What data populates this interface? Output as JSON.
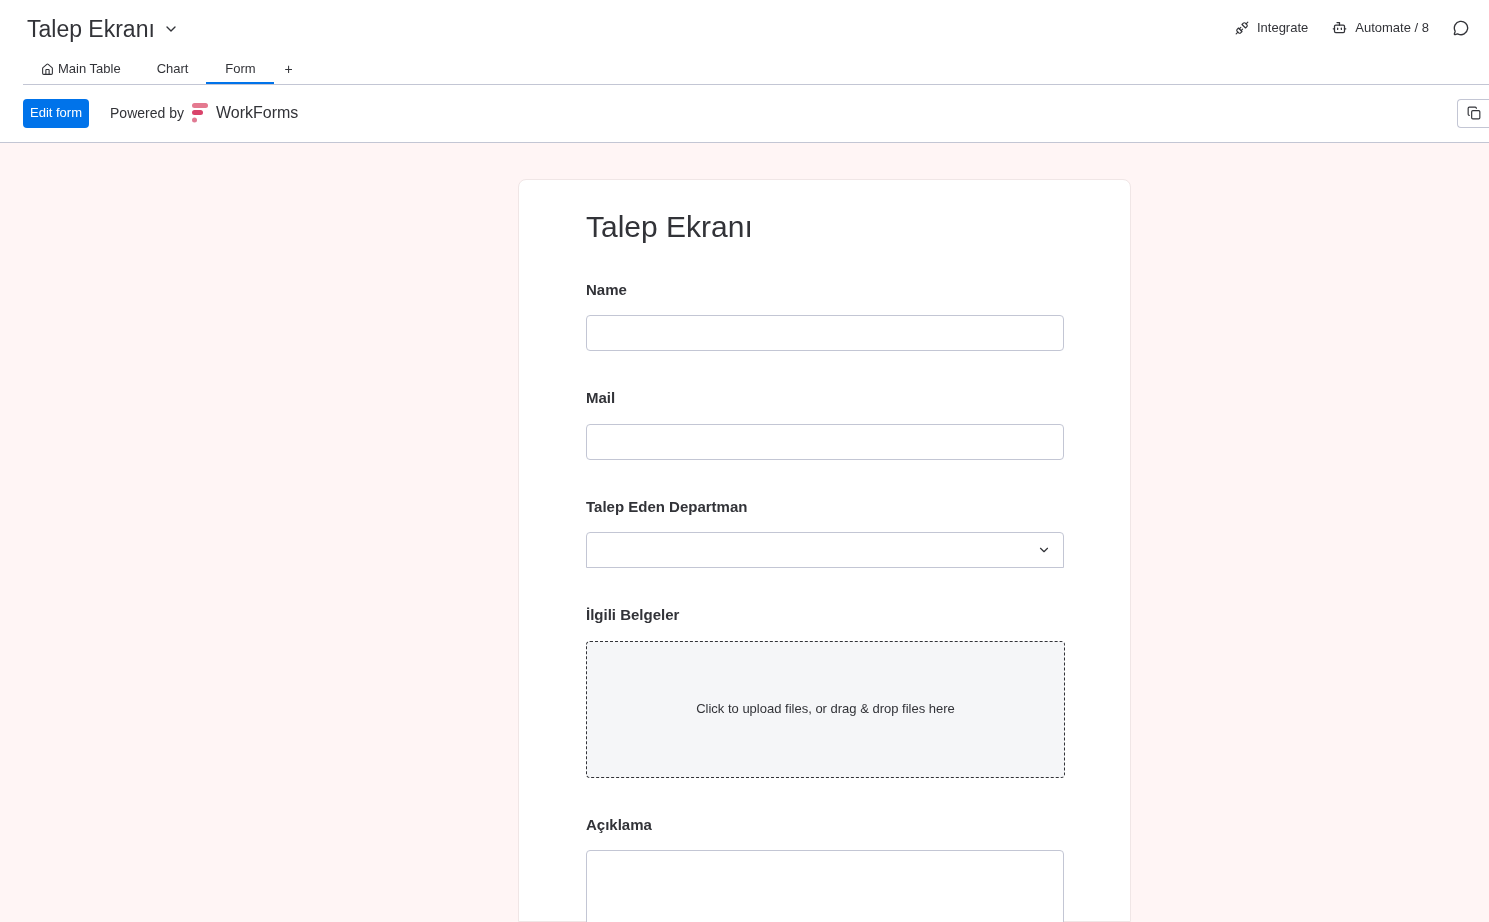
{
  "board": {
    "title": "Talep Ekranı"
  },
  "header_actions": [
    {
      "kind": "integrate",
      "label": "Integrate"
    },
    {
      "kind": "automate",
      "label": "Automate / 8"
    }
  ],
  "tabs": [
    {
      "label": "Main Table",
      "icon": true,
      "selected": false
    },
    {
      "label": "Chart",
      "icon": false,
      "selected": false
    },
    {
      "label": "Form",
      "icon": false,
      "selected": true
    }
  ],
  "add_tab": "+",
  "toolbar": {
    "edit_button": "Edit form",
    "powered_by": "Powered by",
    "brand": "WorkForms"
  },
  "form": {
    "title": "Talep Ekranı",
    "fields": [
      {
        "kind": "text",
        "label": "Name"
      },
      {
        "kind": "text",
        "label": "Mail"
      },
      {
        "kind": "dropdown",
        "label": "Talep Eden Departman"
      },
      {
        "kind": "file",
        "label": "İlgili Belgeler",
        "hint": "Click to upload files, or drag & drop files here"
      },
      {
        "kind": "textarea",
        "label": "Açıklama"
      }
    ]
  }
}
